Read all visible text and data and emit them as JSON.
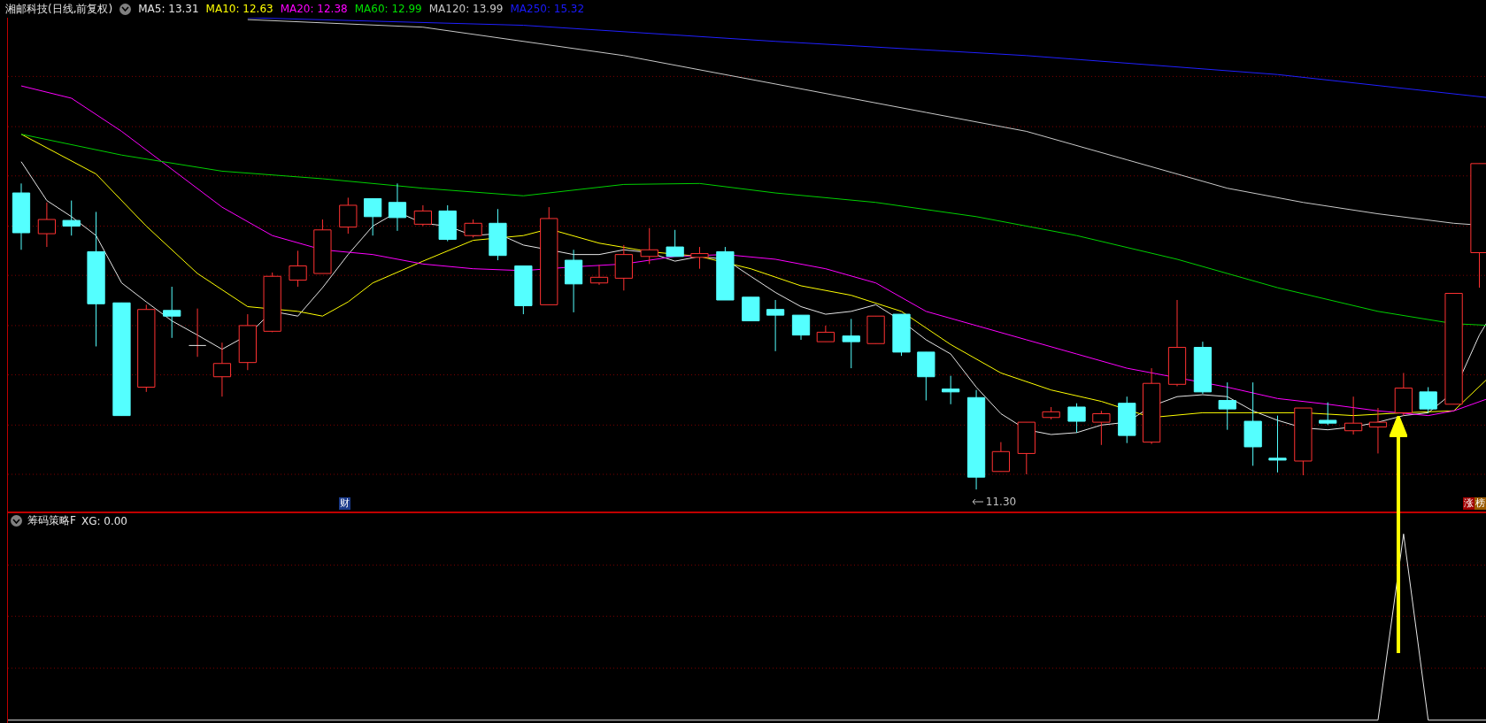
{
  "header": {
    "title": "湘邮科技(日线,前复权)",
    "indicators": [
      {
        "label": "MA5: 13.31",
        "color": "#e6e6e6"
      },
      {
        "label": "MA10: 12.63",
        "color": "#ffff00"
      },
      {
        "label": "MA20: 12.38",
        "color": "#ff00ff"
      },
      {
        "label": "MA60: 12.99",
        "color": "#00e000"
      },
      {
        "label": "MA120: 13.99",
        "color": "#c8c8c8"
      },
      {
        "label": "MA250: 15.32",
        "color": "#1a1aff"
      }
    ]
  },
  "main_chart": {
    "event_marker": "财",
    "low_label": "11.30",
    "badges": [
      {
        "text": "涨",
        "color": "#a00000"
      },
      {
        "text": "榜",
        "color": "#9a5a00"
      }
    ]
  },
  "sub_panel": {
    "title": "筹码策略F",
    "reading": "XG: 0.00"
  }
}
